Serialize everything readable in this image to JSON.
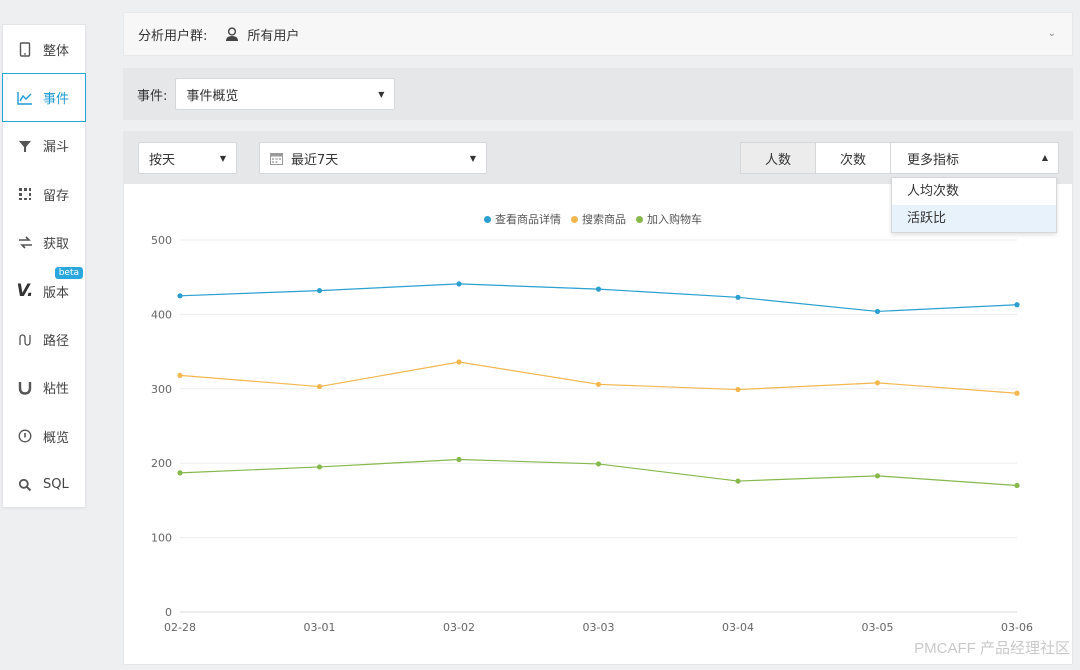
{
  "sidebar": {
    "items": [
      {
        "label": "整体",
        "icon": "phone-icon"
      },
      {
        "label": "事件",
        "icon": "line-chart-icon",
        "active": true
      },
      {
        "label": "漏斗",
        "icon": "funnel-icon"
      },
      {
        "label": "留存",
        "icon": "grid-icon"
      },
      {
        "label": "获取",
        "icon": "transfer-icon"
      },
      {
        "label": "版本",
        "icon": "version-icon",
        "badge": "beta"
      },
      {
        "label": "路径",
        "icon": "path-icon"
      },
      {
        "label": "粘性",
        "icon": "magnet-icon"
      },
      {
        "label": "概览",
        "icon": "gauge-icon"
      },
      {
        "label": "SQL",
        "icon": "search-icon"
      }
    ]
  },
  "filter": {
    "group_label": "分析用户群:",
    "group_value": "所有用户",
    "event_label": "事件:",
    "event_value": "事件概览"
  },
  "controls": {
    "granularity": "按天",
    "date_range": "最近7天",
    "metric_tabs": [
      "人数",
      "次数"
    ],
    "more_metrics": "更多指标",
    "dropdown_options": [
      "人均次数",
      "活跃比"
    ]
  },
  "chart_data": {
    "type": "line",
    "categories": [
      "02-28",
      "03-01",
      "03-02",
      "03-03",
      "03-04",
      "03-05",
      "03-06"
    ],
    "ylim": [
      0,
      500
    ],
    "yticks": [
      0,
      100,
      200,
      300,
      400,
      500
    ],
    "grid": true,
    "legend": "top-center",
    "series": [
      {
        "name": "查看商品详情",
        "color": "#2a9fd0",
        "values": [
          425,
          432,
          441,
          434,
          423,
          404,
          413
        ]
      },
      {
        "name": "搜索商品",
        "color": "#f4b750",
        "values": [
          318,
          303,
          336,
          306,
          299,
          308,
          294
        ]
      },
      {
        "name": "加入购物车",
        "color": "#86b84c",
        "values": [
          187,
          195,
          205,
          199,
          176,
          183,
          170
        ]
      }
    ]
  },
  "watermark": "PMCAFF 产品经理社区"
}
